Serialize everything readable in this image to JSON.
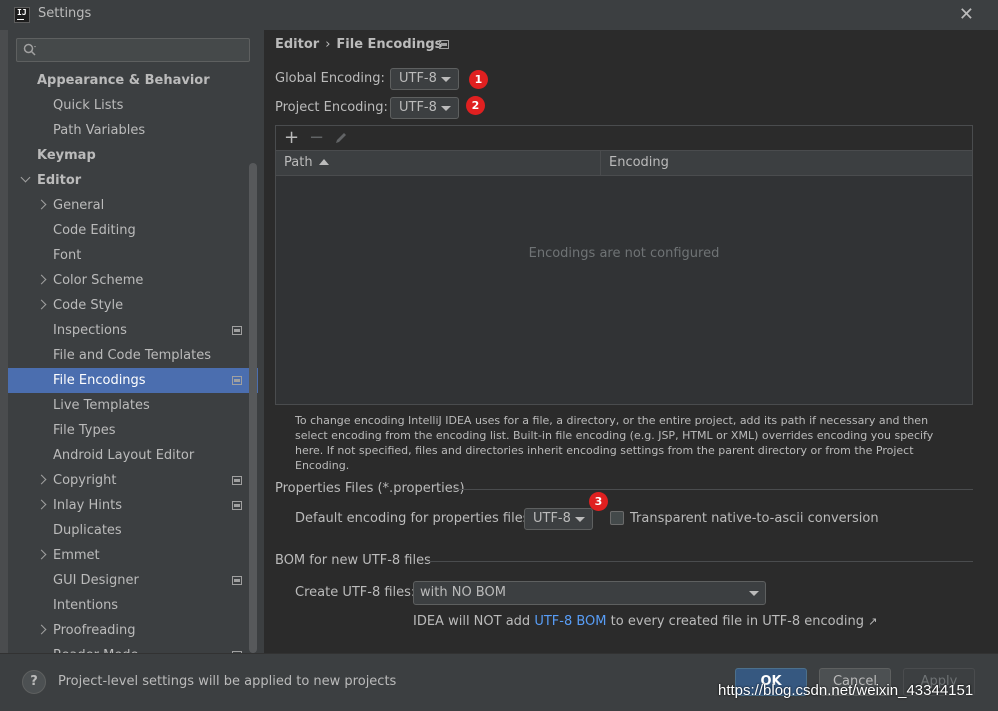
{
  "window": {
    "title": "Settings",
    "icon_text": "IJ"
  },
  "sidebar": {
    "search": {
      "placeholder": ""
    },
    "items": [
      {
        "label": "Appearance & Behavior",
        "bold": true
      },
      {
        "label": "Quick Lists"
      },
      {
        "label": "Path Variables"
      },
      {
        "label": "Keymap",
        "bold": true
      },
      {
        "label": "Editor",
        "bold": true,
        "expanded": true
      },
      {
        "label": "General",
        "collapsed": true
      },
      {
        "label": "Code Editing"
      },
      {
        "label": "Font"
      },
      {
        "label": "Color Scheme",
        "collapsed": true
      },
      {
        "label": "Code Style",
        "collapsed": true
      },
      {
        "label": "Inspections",
        "badge": true
      },
      {
        "label": "File and Code Templates"
      },
      {
        "label": "File Encodings",
        "selected": true,
        "badge": true
      },
      {
        "label": "Live Templates"
      },
      {
        "label": "File Types"
      },
      {
        "label": "Android Layout Editor"
      },
      {
        "label": "Copyright",
        "collapsed": true,
        "badge": true
      },
      {
        "label": "Inlay Hints",
        "collapsed": true,
        "badge": true
      },
      {
        "label": "Duplicates"
      },
      {
        "label": "Emmet",
        "collapsed": true
      },
      {
        "label": "GUI Designer",
        "badge": true
      },
      {
        "label": "Intentions"
      },
      {
        "label": "Proofreading",
        "collapsed": true
      },
      {
        "label": "Reader Mode",
        "badge": true
      }
    ]
  },
  "breadcrumb": {
    "parent": "Editor",
    "separator": "›",
    "current": "File Encodings"
  },
  "encodings": {
    "global_label": "Global Encoding:",
    "global_value": "UTF-8",
    "project_label": "Project Encoding:",
    "project_value": "UTF-8",
    "markers": [
      "1",
      "2",
      "3"
    ]
  },
  "table": {
    "toolbar": {
      "add": "+",
      "remove": "−"
    },
    "columns": [
      "Path",
      "Encoding"
    ],
    "empty_text": "Encodings are not configured"
  },
  "help_text": "To change encoding IntelliJ IDEA uses for a file, a directory, or the entire project, add its path if necessary and then select encoding from the encoding list. Built-in file encoding (e.g. JSP, HTML or XML) overrides encoding you specify here. If not specified, files and directories inherit encoding settings from the parent directory or from the Project Encoding.",
  "properties": {
    "section_title": "Properties Files (*.properties)",
    "default_label": "Default encoding for properties files:",
    "default_value": "UTF-8",
    "transparent_label": "Transparent native-to-ascii conversion",
    "transparent_checked": false
  },
  "bom": {
    "section_title": "BOM for new UTF-8 files",
    "create_label": "Create UTF-8 files:",
    "create_value": "with NO BOM",
    "note_prefix": "IDEA will NOT add ",
    "note_link": "UTF-8 BOM",
    "note_suffix": " to every created file in UTF-8 encoding",
    "note_arrow": "↗"
  },
  "footer": {
    "help": "?",
    "message": "Project-level settings will be applied to new projects",
    "ok": "OK",
    "cancel": "Cancel",
    "apply": "Apply"
  },
  "watermark": "https://blog.csdn.net/weixin_43344151",
  "colors": {
    "accent": "#4b6eaf",
    "ok_button": "#365880",
    "link": "#589df6",
    "marker": "#e02020"
  }
}
